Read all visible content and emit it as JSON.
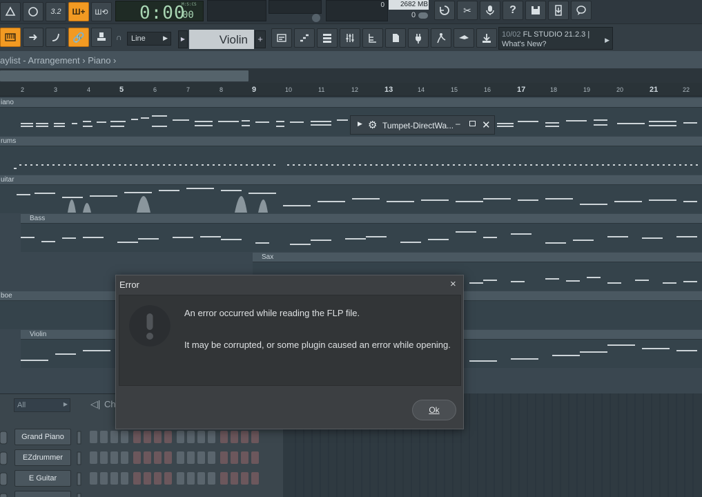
{
  "toolbar": {
    "time_big": "0:00",
    "time_small": "00",
    "time_label": "M:S:CS",
    "cpu_value": "0",
    "mem_value": "2682",
    "mem_unit": "MB",
    "poly_value": "0",
    "snap_mode": "Line",
    "instrument": "Violin",
    "news_date": "10/02",
    "news_title": "FL STUDIO 21.2.3 |",
    "news_link": "What's New?"
  },
  "breadcrumb": {
    "part1": "aylist",
    "sep1": " - ",
    "part2": "Arrangement",
    "sep2": " › ",
    "part3": "Piano",
    "sep3": " ›"
  },
  "ruler": {
    "bars": [
      "2",
      "3",
      "4",
      "5",
      "6",
      "7",
      "8",
      "9",
      "10",
      "11",
      "12",
      "13",
      "14",
      "15",
      "16",
      "17",
      "18",
      "19",
      "20",
      "21",
      "22"
    ]
  },
  "tracks": [
    {
      "name": "iano"
    },
    {
      "name": "rums"
    },
    {
      "name": "uitar"
    },
    {
      "name": "Bass"
    },
    {
      "name": "Sax"
    },
    {
      "name": "boe"
    },
    {
      "name": "Violin"
    }
  ],
  "plugin_window": {
    "title": "Tumpet-DirectWa..."
  },
  "channel_rack": {
    "filter": "All",
    "title_fragment": "Ch",
    "channels": [
      "Grand Piano",
      "EZdrummer",
      "E Guitar"
    ]
  },
  "dialog": {
    "title": "Error",
    "message_line1": "An error occurred while reading the FLP file.",
    "message_line2": "It may be corrupted, or some plugin caused an error while opening.",
    "ok_label": "Ok",
    "close_glyph": "×"
  },
  "colors": {
    "accent_orange": "#f29a22",
    "dialog_bg": "#3c3f42",
    "playlist_bg": "#35434b"
  }
}
